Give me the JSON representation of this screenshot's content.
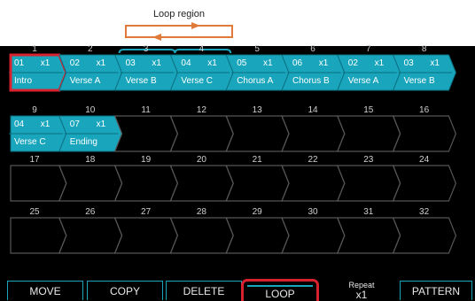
{
  "loop_region_label": "Loop region",
  "colors": {
    "accent": "#19a6bd",
    "selected": "#d9222f",
    "empty": "#555555",
    "background": "#000000"
  },
  "slots": [
    {
      "num": "1",
      "pattern": "01",
      "repeat": "x1",
      "section": "Intro",
      "selected": true
    },
    {
      "num": "2",
      "pattern": "02",
      "repeat": "x1",
      "section": "Verse A"
    },
    {
      "num": "3",
      "pattern": "03",
      "repeat": "x1",
      "section": "Verse B",
      "loop": true
    },
    {
      "num": "4",
      "pattern": "04",
      "repeat": "x1",
      "section": "Verse C",
      "loop": true
    },
    {
      "num": "5",
      "pattern": "05",
      "repeat": "x1",
      "section": "Chorus A"
    },
    {
      "num": "6",
      "pattern": "06",
      "repeat": "x1",
      "section": "Chorus B"
    },
    {
      "num": "7",
      "pattern": "02",
      "repeat": "x1",
      "section": "Verse A"
    },
    {
      "num": "8",
      "pattern": "03",
      "repeat": "x1",
      "section": "Verse B"
    },
    {
      "num": "9",
      "pattern": "04",
      "repeat": "x1",
      "section": "Verse C"
    },
    {
      "num": "10",
      "pattern": "07",
      "repeat": "x1",
      "section": "Ending"
    },
    {
      "num": "11"
    },
    {
      "num": "12"
    },
    {
      "num": "13"
    },
    {
      "num": "14"
    },
    {
      "num": "15"
    },
    {
      "num": "16"
    },
    {
      "num": "17"
    },
    {
      "num": "18"
    },
    {
      "num": "19"
    },
    {
      "num": "20"
    },
    {
      "num": "21"
    },
    {
      "num": "22"
    },
    {
      "num": "23"
    },
    {
      "num": "24"
    },
    {
      "num": "25"
    },
    {
      "num": "26"
    },
    {
      "num": "27"
    },
    {
      "num": "28"
    },
    {
      "num": "29"
    },
    {
      "num": "30"
    },
    {
      "num": "31"
    },
    {
      "num": "32"
    }
  ],
  "buttons": {
    "move": "MOVE",
    "copy": "COPY",
    "delete": "DELETE",
    "loop": "LOOP",
    "repeat_label": "Repeat",
    "repeat_value": "x1",
    "pattern": "PATTERN"
  }
}
